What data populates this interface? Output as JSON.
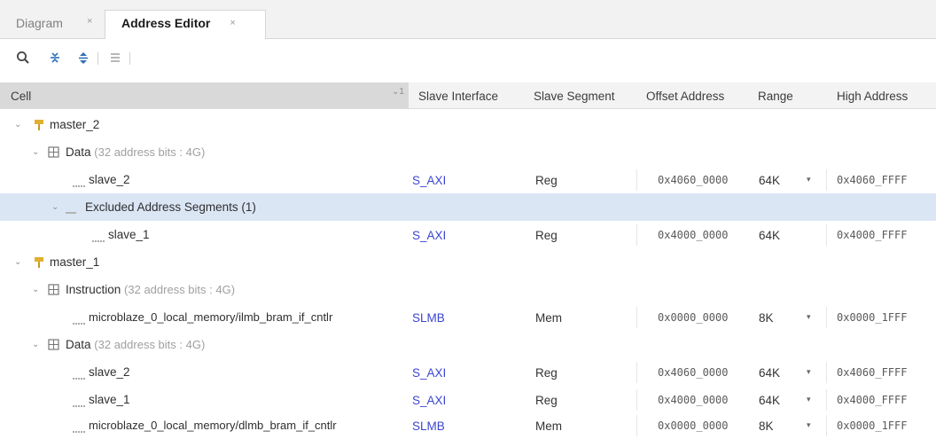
{
  "tabs": [
    {
      "label": "Diagram",
      "active": false
    },
    {
      "label": "Address Editor",
      "active": true
    }
  ],
  "toolbar": {
    "icons": [
      "search-icon",
      "collapse-all-icon",
      "expand-all-icon",
      "auto-assign-icon"
    ]
  },
  "columns": {
    "cell": "Cell",
    "sort_indicator": "1",
    "slave_interface": "Slave Interface",
    "slave_segment": "Slave Segment",
    "offset_address": "Offset Address",
    "range": "Range",
    "high_address": "High Address"
  },
  "tree": {
    "master_2": {
      "name": "master_2",
      "data": {
        "label": "Data",
        "detail": "(32 address bits : 4G)",
        "slave_2": {
          "cell": "slave_2",
          "interface": "S_AXI",
          "segment": "Reg",
          "offset": "0x4060_0000",
          "range": "64K",
          "high": "0x4060_FFFF"
        },
        "excluded": {
          "label": "Excluded Address Segments (1)"
        },
        "slave_1": {
          "cell": "slave_1",
          "interface": "S_AXI",
          "segment": "Reg",
          "offset": "0x4000_0000",
          "range": "64K",
          "high": "0x4000_FFFF"
        }
      }
    },
    "master_1": {
      "name": "master_1",
      "instruction": {
        "label": "Instruction",
        "detail": "(32 address bits : 4G)",
        "ilmb": {
          "cell": "microblaze_0_local_memory/ilmb_bram_if_cntlr",
          "interface": "SLMB",
          "segment": "Mem",
          "offset": "0x0000_0000",
          "range": "8K",
          "high": "0x0000_1FFF"
        }
      },
      "data": {
        "label": "Data",
        "detail": "(32 address bits : 4G)",
        "slave_2": {
          "cell": "slave_2",
          "interface": "S_AXI",
          "segment": "Reg",
          "offset": "0x4060_0000",
          "range": "64K",
          "high": "0x4060_FFFF"
        },
        "slave_1": {
          "cell": "slave_1",
          "interface": "S_AXI",
          "segment": "Reg",
          "offset": "0x4000_0000",
          "range": "64K",
          "high": "0x4000_FFFF"
        },
        "dlmb": {
          "cell": "microblaze_0_local_memory/dlmb_bram_if_cntlr",
          "interface": "SLMB",
          "segment": "Mem",
          "offset": "0x0000_0000",
          "range": "8K",
          "high": "0x0000_1FFF"
        }
      }
    }
  },
  "colors": {
    "link": "#3b45d0",
    "selection": "#dbe6f5",
    "header_bg": "#f3f3f3",
    "master_icon": "#e0b030"
  }
}
